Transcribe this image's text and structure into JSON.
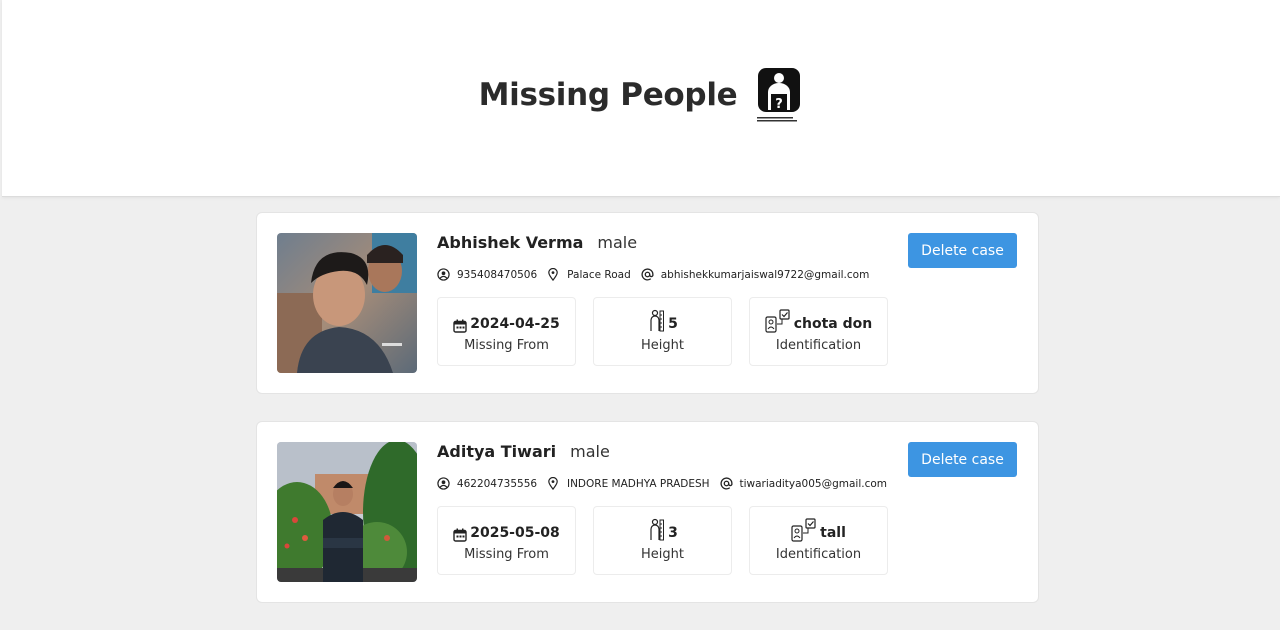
{
  "header": {
    "title": "Missing People",
    "logo_icon": "missing-person-logo"
  },
  "cases": [
    {
      "name": "Abhishek Verma",
      "gender": "male",
      "phone": "935408470506",
      "address": "Palace Road",
      "email": "abhishekkumarjaiswal9722@gmail.com",
      "missing_from": "2024-04-25",
      "missing_from_label": "Missing From",
      "height": "5",
      "height_label": "Height",
      "identification": "chota don",
      "identification_label": "Identification",
      "delete_label": "Delete case"
    },
    {
      "name": "Aditya Tiwari",
      "gender": "male",
      "phone": "462204735556",
      "address": "INDORE MADHYA PRADESH",
      "email": "tiwariaditya005@gmail.com",
      "missing_from": "2025-05-08",
      "missing_from_label": "Missing From",
      "height": "3",
      "height_label": "Height",
      "identification": "tall",
      "identification_label": "Identification",
      "delete_label": "Delete case"
    }
  ],
  "colors": {
    "accent": "#3d95e2",
    "background": "#efefef",
    "card": "#ffffff"
  }
}
